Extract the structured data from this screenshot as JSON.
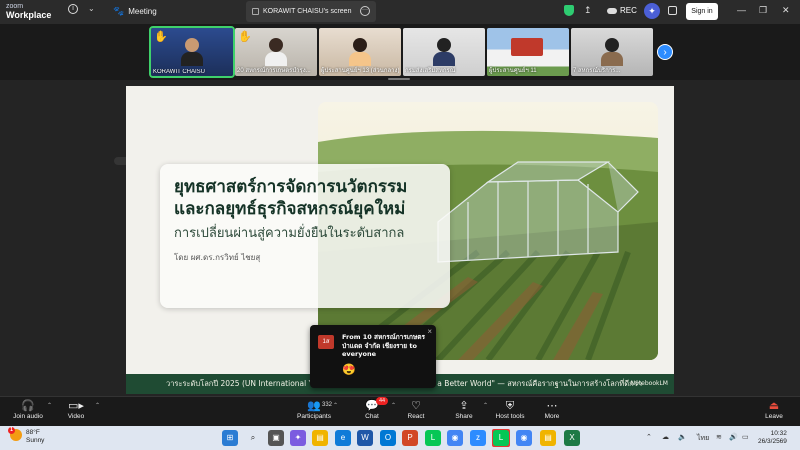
{
  "titlebar": {
    "logo_line1": "zoom",
    "logo_line2": "Workplace",
    "info_icon": "i",
    "meeting_label": "Meeting",
    "tab_title": "KORAWIT CHAISU's screen",
    "rec_label": "REC",
    "signin_label": "Sign in",
    "ai_icon": "✦"
  },
  "participants": [
    {
      "name": "KORAWIT CHAISU",
      "hand": true,
      "active": true
    },
    {
      "name": "20 สหกรณ์การเกษตรบำรุง...",
      "hand": true,
      "active": false
    },
    {
      "name": "ผู้ประสานศูนย์ฯ 13 (ส่วนกลาง)",
      "hand": false,
      "active": false
    },
    {
      "name": "กรมส่งเสริมสหกรณ์",
      "hand": false,
      "active": false
    },
    {
      "name": "ผู้ประสานศูนย์ฯ 11",
      "hand": false,
      "active": false
    },
    {
      "name": "7 สหกรณ์บริการ...",
      "hand": false,
      "active": false
    }
  ],
  "slide": {
    "title_line1": "ยุทธศาสตร์การจัดการนวัตกรรม",
    "title_line2": "และกลยุทธ์ธุรกิจสหกรณ์ยุคใหม่",
    "subtitle": "การเปลี่ยนผ่านสู่ความยั่งยืนในระดับสากล",
    "author": "โดย ผศ.ดร.กรวิทย์ ไชยสุ",
    "footer_left": "วาระระดับโลกปี 2025 (UN International Year",
    "footer_right": "ild a Better World\" — สหกรณ์คือรากฐานในการสร้างโลกที่ดีกว่า",
    "watermark": "NotebookLM"
  },
  "toast": {
    "avatar": "1ส",
    "message": "From 10 สหกรณ์การเกษตรป่าแดด จำกัด เชียงราย to everyone",
    "emoji": "😍",
    "close": "×"
  },
  "toolbar": {
    "join_audio": "Join audio",
    "video": "Video",
    "participants": "Participants",
    "participants_count": "332",
    "chat": "Chat",
    "chat_badge": "44",
    "react": "React",
    "share": "Share",
    "host_tools": "Host tools",
    "more": "More",
    "leave": "Leave"
  },
  "taskbar": {
    "weather_temp": "88°F",
    "weather_desc": "Sunny",
    "weather_badge": "1",
    "lang": "ไทย",
    "time": "10:32",
    "date": "26/3/2569"
  },
  "colors": {
    "accent": "#2d8cff",
    "active_speaker": "#3fd16b",
    "slide_footer": "#1f4b33",
    "leave": "#e74c3c"
  }
}
